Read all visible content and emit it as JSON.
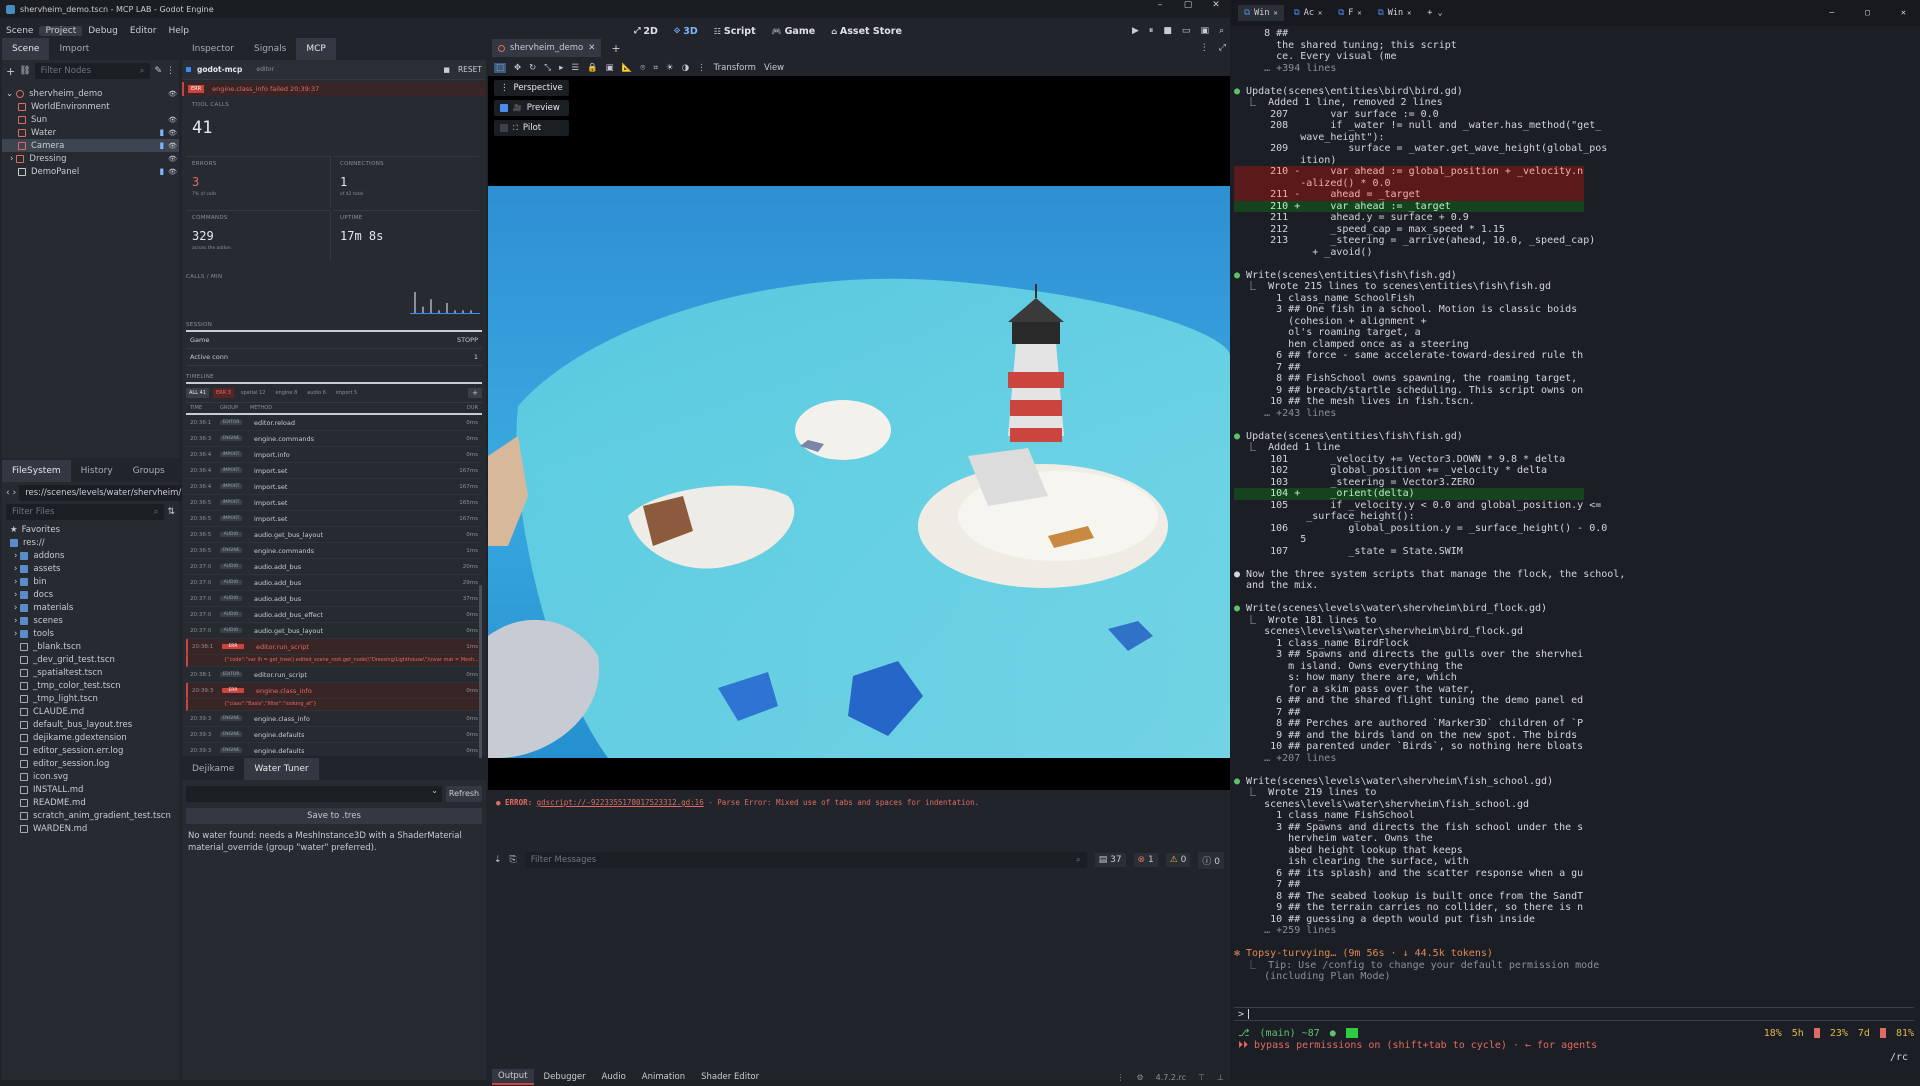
{
  "window": {
    "title": "shervheim_demo.tscn - MCP LAB - Godot Engine"
  },
  "menu": [
    "Scene",
    "Project",
    "Debug",
    "Editor",
    "Help"
  ],
  "workspaces": [
    {
      "label": "2D",
      "icon": "2d-icon"
    },
    {
      "label": "3D",
      "icon": "3d-icon"
    },
    {
      "label": "Script",
      "icon": "script-icon"
    },
    {
      "label": "Game",
      "icon": "game-icon"
    },
    {
      "label": "Asset Store",
      "icon": "asset-store-icon"
    }
  ],
  "scene_dock": {
    "tabs": [
      "Scene",
      "Import"
    ],
    "filter_placeholder": "Filter Nodes",
    "nodes": [
      {
        "name": "shervheim_demo",
        "depth": 0,
        "color": "#e06b62"
      },
      {
        "name": "WorldEnvironment",
        "depth": 1,
        "color": "#e06b62"
      },
      {
        "name": "Sun",
        "depth": 1,
        "color": "#e06b62"
      },
      {
        "name": "Water",
        "depth": 1,
        "color": "#e06b62"
      },
      {
        "name": "Camera",
        "depth": 1,
        "color": "#e06b62",
        "selected": true
      },
      {
        "name": "Dressing",
        "depth": 1,
        "color": "#e06b62"
      },
      {
        "name": "DemoPanel",
        "depth": 1,
        "color": "#c9ccd2"
      }
    ]
  },
  "filesystem": {
    "tabs": [
      "FileSystem",
      "History",
      "Groups"
    ],
    "path": "res://scenes/levels/water/shervheim/",
    "filter_placeholder": "Filter Files",
    "items": [
      {
        "name": "Favorites",
        "type": "fav",
        "depth": 0
      },
      {
        "name": "res://",
        "type": "folder",
        "depth": 0
      },
      {
        "name": "addons",
        "type": "folder",
        "depth": 1
      },
      {
        "name": "assets",
        "type": "folder",
        "depth": 1
      },
      {
        "name": "bin",
        "type": "folder",
        "depth": 1
      },
      {
        "name": "docs",
        "type": "folder",
        "depth": 1
      },
      {
        "name": "materials",
        "type": "folder",
        "depth": 1
      },
      {
        "name": "scenes",
        "type": "folder",
        "depth": 1
      },
      {
        "name": "tools",
        "type": "folder",
        "depth": 1
      },
      {
        "name": "_blank.tscn",
        "type": "file",
        "depth": 1
      },
      {
        "name": "_dev_grid_test.tscn",
        "type": "file",
        "depth": 1
      },
      {
        "name": "_spatialtest.tscn",
        "type": "file",
        "depth": 1
      },
      {
        "name": "_tmp_color_test.tscn",
        "type": "file",
        "depth": 1
      },
      {
        "name": "_tmp_light.tscn",
        "type": "file",
        "depth": 1
      },
      {
        "name": "CLAUDE.md",
        "type": "file",
        "depth": 1
      },
      {
        "name": "default_bus_layout.tres",
        "type": "file",
        "depth": 1
      },
      {
        "name": "dejikame.gdextension",
        "type": "file",
        "depth": 1
      },
      {
        "name": "editor_session.err.log",
        "type": "file",
        "depth": 1
      },
      {
        "name": "editor_session.log",
        "type": "file",
        "depth": 1
      },
      {
        "name": "icon.svg",
        "type": "file",
        "depth": 1
      },
      {
        "name": "INSTALL.md",
        "type": "file",
        "depth": 1
      },
      {
        "name": "README.md",
        "type": "file",
        "depth": 1
      },
      {
        "name": "scratch_anim_gradient_test.tscn",
        "type": "file",
        "depth": 1
      },
      {
        "name": "WARDEN.md",
        "type": "file",
        "depth": 1
      }
    ]
  },
  "inspector": {
    "tabs": [
      "Inspector",
      "Signals",
      "MCP"
    ],
    "plugin": "godot-mcp",
    "plugin_tag": "editor",
    "reset": "RESET",
    "alert_badge": "ERR",
    "alert": "engine.class_info failed 20:39:37",
    "stats": [
      {
        "label": "TOOL CALLS",
        "value": "41",
        "sub": ""
      },
      {
        "label": "ERRORS",
        "value": "3",
        "sub": "7% of calls",
        "red": true
      },
      {
        "label": "CONNECTIONS",
        "value": "1",
        "sub": "of 42 total"
      },
      {
        "label": "COMMANDS",
        "value": "329",
        "sub": "across the addon"
      },
      {
        "label": "UPTIME",
        "value": "17m 8s",
        "sub": ""
      }
    ],
    "calls_label": "CALLS / MIN",
    "calls_per_min": [
      6,
      2,
      4,
      1,
      3,
      1,
      1,
      1
    ],
    "session_label": "SESSION",
    "session": [
      {
        "k": "Game",
        "v": "STOPP"
      },
      {
        "k": "Active conn",
        "v": "1"
      }
    ],
    "timeline_label": "TIMELINE",
    "filters": [
      "ALL 41",
      "ERR 3",
      "spatial 12",
      "engine 8",
      "audio 6",
      "import 5"
    ],
    "cols": [
      "TIME",
      "GROUP",
      "METHOD",
      "DUR"
    ],
    "rows": [
      {
        "t": "20:36:1",
        "g": "EDITOR",
        "m": "editor.reload",
        "d": "0ms"
      },
      {
        "t": "20:36:3",
        "g": "ENGINE",
        "m": "engine.commands",
        "d": "0ms"
      },
      {
        "t": "20:36:4",
        "g": "IMPORT",
        "m": "import.info",
        "d": "0ms"
      },
      {
        "t": "20:36:4",
        "g": "IMPORT",
        "m": "import.set",
        "d": "167ms"
      },
      {
        "t": "20:36:4",
        "g": "IMPORT",
        "m": "import.set",
        "d": "167ms"
      },
      {
        "t": "20:36:5",
        "g": "IMPORT",
        "m": "import.set",
        "d": "165ms"
      },
      {
        "t": "20:36:5",
        "g": "IMPORT",
        "m": "import.set",
        "d": "167ms"
      },
      {
        "t": "20:36:5",
        "g": "AUDIO",
        "m": "audio.get_bus_layout",
        "d": "0ms"
      },
      {
        "t": "20:36:5",
        "g": "ENGINE",
        "m": "engine.commands",
        "d": "1ms"
      },
      {
        "t": "20:37:0",
        "g": "AUDIO",
        "m": "audio.add_bus",
        "d": "20ms"
      },
      {
        "t": "20:37:0",
        "g": "AUDIO",
        "m": "audio.add_bus",
        "d": "29ms"
      },
      {
        "t": "20:37:0",
        "g": "AUDIO",
        "m": "audio.add_bus",
        "d": "37ms"
      },
      {
        "t": "20:37:0",
        "g": "AUDIO",
        "m": "audio.add_bus_effect",
        "d": "0ms"
      },
      {
        "t": "20:37:0",
        "g": "AUDIO",
        "m": "audio.get_bus_layout",
        "d": "0ms"
      },
      {
        "t": "20:38:1",
        "g": "ERR",
        "m": "editor.run_script",
        "d": "1ms",
        "err": true,
        "detail": "{\"code\":\"var lh = get_tree().edited_scene_root.get_node(\\\"Dressing/Lighthouse\\\")\\nvar mat = Mesh..."
      },
      {
        "t": "20:38:1",
        "g": "EDITOR",
        "m": "editor.run_script",
        "d": "0ms"
      },
      {
        "t": "20:39:3",
        "g": "ERR",
        "m": "engine.class_info",
        "d": "0ms",
        "err": true,
        "detail": "{\"class\":\"Basis\",\"filter\":\"looking_at\"}"
      },
      {
        "t": "20:39:3",
        "g": "ENGINE",
        "m": "engine.class_info",
        "d": "0ms"
      },
      {
        "t": "20:39:3",
        "g": "ENGINE",
        "m": "engine.defaults",
        "d": "0ms"
      },
      {
        "t": "20:39:3",
        "g": "ENGINE",
        "m": "engine.defaults",
        "d": "0ms"
      },
      {
        "t": "20:39:4",
        "g": "ENGINE",
        "m": "engine.docs",
        "d": "149ms"
      }
    ]
  },
  "bottom_left": {
    "tabs": [
      "Dejikame",
      "Water Tuner"
    ],
    "refresh": "Refresh",
    "save": "Save to .tres",
    "message": "No water found: needs a MeshInstance3D with a ShaderMaterial material_override (group \"water\" preferred)."
  },
  "viewport": {
    "tab": "shervheim_demo",
    "menus": [
      "Transform",
      "View"
    ],
    "overlay": [
      {
        "label": "Perspective",
        "checked": null
      },
      {
        "label": "Preview",
        "checked": true
      },
      {
        "label": "Pilot",
        "checked": false
      }
    ]
  },
  "output": {
    "error_prefix": "ERROR:",
    "error_link": "gdscript://-9223355178017523312.gd:16",
    "error_msg": " - Parse Error: Mixed use of tabs and spaces for indentation.",
    "filter_placeholder": "Filter Messages",
    "counts": [
      "37",
      "1",
      "0",
      "0"
    ],
    "tabs": [
      "Output",
      "Debugger",
      "Audio",
      "Animation",
      "Shader Editor"
    ],
    "version": "4.7.2.rc"
  },
  "terminal": {
    "tabs": [
      "Win",
      "Ac",
      "F",
      "Win"
    ],
    "lines": [
      {
        "s": "     8 ##",
        "c": ""
      },
      {
        "s": "       the shared tuning; this script",
        "c": ""
      },
      {
        "s": "       ce. Every visual (me",
        "c": ""
      },
      {
        "s": "     … +394 lines",
        "c": "dim"
      },
      {
        "s": "",
        "c": ""
      },
      {
        "s": "● Update(scenes\\entities\\bird\\bird.gd)",
        "c": "head"
      },
      {
        "s": "  ⎿  Added 1 line, removed 2 lines",
        "c": ""
      },
      {
        "s": "      207       var surface := 0.0",
        "c": ""
      },
      {
        "s": "      208       if _water != null and _water.has_method(\"get_",
        "c": ""
      },
      {
        "s": "           wave_height\"):",
        "c": ""
      },
      {
        "s": "      209          surface = _water.get_wave_height(global_pos",
        "c": ""
      },
      {
        "s": "           ition)",
        "c": ""
      },
      {
        "s": "      210 -     var ahead := global_position + _velocity.norm",
        "c": "del"
      },
      {
        "s": "           -alized() * 0.0",
        "c": "del"
      },
      {
        "s": "      211 -     ahead = _target",
        "c": "del"
      },
      {
        "s": "      210 +     var ahead := _target",
        "c": "add"
      },
      {
        "s": "      211       ahead.y = surface + 0.9",
        "c": ""
      },
      {
        "s": "      212       _speed_cap = max_speed * 1.15",
        "c": ""
      },
      {
        "s": "      213       _steering = _arrive(ahead, 10.0, _speed_cap)",
        "c": ""
      },
      {
        "s": "             + _avoid()",
        "c": ""
      },
      {
        "s": "",
        "c": ""
      },
      {
        "s": "● Write(scenes\\entities\\fish\\fish.gd)",
        "c": "head"
      },
      {
        "s": "  ⎿  Wrote 215 lines to scenes\\entities\\fish\\fish.gd",
        "c": ""
      },
      {
        "s": "       1 class_name SchoolFish",
        "c": ""
      },
      {
        "s": "       3 ## One fish in a school. Motion is classic boids",
        "c": ""
      },
      {
        "s": "         (cohesion + alignment +",
        "c": ""
      },
      {
        "s": "         ol's roaming target, a",
        "c": ""
      },
      {
        "s": "         hen clamped once as a steering",
        "c": ""
      },
      {
        "s": "       6 ## force - same accelerate-toward-desired rule th",
        "c": ""
      },
      {
        "s": "       7 ##",
        "c": ""
      },
      {
        "s": "       8 ## FishSchool owns spawning, the roaming target,",
        "c": ""
      },
      {
        "s": "       9 ## breach/startle scheduling. This script owns on",
        "c": ""
      },
      {
        "s": "      10 ## the mesh lives in fish.tscn.",
        "c": ""
      },
      {
        "s": "     … +243 lines",
        "c": "dim"
      },
      {
        "s": "",
        "c": ""
      },
      {
        "s": "● Update(scenes\\entities\\fish\\fish.gd)",
        "c": "head"
      },
      {
        "s": "  ⎿  Added 1 line",
        "c": ""
      },
      {
        "s": "      101       _velocity += Vector3.DOWN * 9.8 * delta",
        "c": ""
      },
      {
        "s": "      102       global_position += _velocity * delta",
        "c": ""
      },
      {
        "s": "      103       _steering = Vector3.ZERO",
        "c": ""
      },
      {
        "s": "      104 +     _orient(delta)",
        "c": "add"
      },
      {
        "s": "      105       if _velocity.y < 0.0 and global_position.y <=",
        "c": ""
      },
      {
        "s": "            _surface_height():",
        "c": ""
      },
      {
        "s": "      106          global_position.y = _surface_height() - 0.0",
        "c": ""
      },
      {
        "s": "           5",
        "c": ""
      },
      {
        "s": "      107          _state = State.SWIM",
        "c": ""
      },
      {
        "s": "",
        "c": ""
      },
      {
        "s": "● Now the three system scripts that manage the flock, the school,",
        "c": "note"
      },
      {
        "s": "  and the mix.",
        "c": ""
      },
      {
        "s": "",
        "c": ""
      },
      {
        "s": "● Write(scenes\\levels\\water\\shervheim\\bird_flock.gd)",
        "c": "head"
      },
      {
        "s": "  ⎿  Wrote 181 lines to",
        "c": ""
      },
      {
        "s": "     scenes\\levels\\water\\shervheim\\bird_flock.gd",
        "c": ""
      },
      {
        "s": "       1 class_name BirdFlock",
        "c": ""
      },
      {
        "s": "       3 ## Spawns and directs the gulls over the shervhei",
        "c": ""
      },
      {
        "s": "         m island. Owns everything the",
        "c": ""
      },
      {
        "s": "         s: how many there are, which",
        "c": ""
      },
      {
        "s": "         for a skim pass over the water,",
        "c": ""
      },
      {
        "s": "       6 ## and the shared flight tuning the demo panel ed",
        "c": ""
      },
      {
        "s": "       7 ##",
        "c": ""
      },
      {
        "s": "       8 ## Perches are authored `Marker3D` children of `P",
        "c": ""
      },
      {
        "s": "       9 ## and the birds land on the new spot. The birds",
        "c": ""
      },
      {
        "s": "      10 ## parented under `Birds`, so nothing here bloats",
        "c": ""
      },
      {
        "s": "     … +207 lines",
        "c": "dim"
      },
      {
        "s": "",
        "c": ""
      },
      {
        "s": "● Write(scenes\\levels\\water\\shervheim\\fish_school.gd)",
        "c": "head"
      },
      {
        "s": "  ⎿  Wrote 219 lines to",
        "c": ""
      },
      {
        "s": "     scenes\\levels\\water\\shervheim\\fish_school.gd",
        "c": ""
      },
      {
        "s": "       1 class_name FishSchool",
        "c": ""
      },
      {
        "s": "       3 ## Spawns and directs the fish school under the s",
        "c": ""
      },
      {
        "s": "         hervheim water. Owns the",
        "c": ""
      },
      {
        "s": "         abed height lookup that keeps",
        "c": ""
      },
      {
        "s": "         ish clearing the surface, with",
        "c": ""
      },
      {
        "s": "       6 ## its splash) and the scatter response when a gu",
        "c": ""
      },
      {
        "s": "       7 ##",
        "c": ""
      },
      {
        "s": "       8 ## The seabed lookup is built once from the SandT",
        "c": ""
      },
      {
        "s": "       9 ## the terrain carries no collider, so there is n",
        "c": ""
      },
      {
        "s": "      10 ## guessing a depth would put fish inside",
        "c": ""
      },
      {
        "s": "     … +259 lines",
        "c": "dim"
      },
      {
        "s": "",
        "c": ""
      },
      {
        "s": "✻ Topsy-turvying… (9m 56s · ↓ 44.5k tokens)",
        "c": "orange"
      },
      {
        "s": "  ⎿  Tip: Use /config to change your default permission mode",
        "c": "dim"
      },
      {
        "s": "     (including Plan Mode)",
        "c": "dim"
      }
    ],
    "prompt": ">",
    "status_left": "(main) ~87",
    "status_stats": [
      "18%",
      "5h",
      "23%",
      "7d",
      "81%"
    ],
    "bypass": "⏵⏵ bypass permissions on (shift+tab to cycle) · ← for agents",
    "rc": "/rc"
  }
}
